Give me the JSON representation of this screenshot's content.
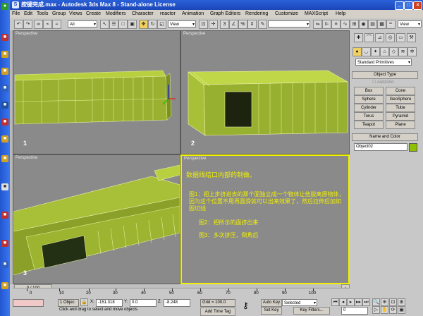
{
  "window": {
    "title": "按键完成.max - Autodesk 3ds Max 8 - Stand-alone License",
    "controls": [
      "_",
      "□",
      "×"
    ]
  },
  "menu": [
    "File",
    "Edit",
    "Tools",
    "Group",
    "Views",
    "Create",
    "Modifiers",
    "Character",
    "reactor",
    "Animation",
    "Graph Editors",
    "Rendering",
    "Customize",
    "MAXScript",
    "Help"
  ],
  "toolbar": {
    "filter": "All",
    "refcoord": "View",
    "named_sel": "",
    "view2": "View"
  },
  "viewports": [
    {
      "label": "Perspective",
      "number": "1"
    },
    {
      "label": "Perspective",
      "number": "2"
    },
    {
      "label": "Perspective",
      "number": "3"
    },
    {
      "label": "Perspective"
    }
  ],
  "notes": {
    "title": "数据线结口内部的制做。",
    "step1": "图1：把上步挤进去的那个面独立成一个物体让他脱离原物体，因为这个位置不用再圆滑就可以出来效果了，然后拉伸后加如图切线",
    "step2": "图2：把所示的面挤出来",
    "step3": "图3：多次挤压，倒角后"
  },
  "command_panel": {
    "category": "Standard Primitives",
    "object_type_header": "Object Type",
    "autogrid": "AutoGrid",
    "buttons": [
      "Box",
      "Cone",
      "Sphere",
      "GeoSphere",
      "Cylinder",
      "Tube",
      "Torus",
      "Pyramid",
      "Teapot",
      "Plane"
    ],
    "name_color_header": "Name and Color",
    "object_name": "Object02",
    "object_color": "#8cc000"
  },
  "timeline": {
    "frame": "0 / 100",
    "ticks": [
      "0",
      "10",
      "20",
      "30",
      "40",
      "50",
      "60",
      "70",
      "80",
      "90",
      "100"
    ]
  },
  "status": {
    "selection": "1 Objec",
    "x": "-151.318",
    "y": "0.0",
    "z": "-8.248",
    "grid": "Grid = 100.0",
    "prompt": "Click and drag to select and move objects",
    "add_time_tag": "Add Time Tag",
    "auto_key": "Auto Key",
    "set_key": "Set Key",
    "selected": "Selected",
    "key_filters": "Key Filters...",
    "frame_field": "0"
  }
}
